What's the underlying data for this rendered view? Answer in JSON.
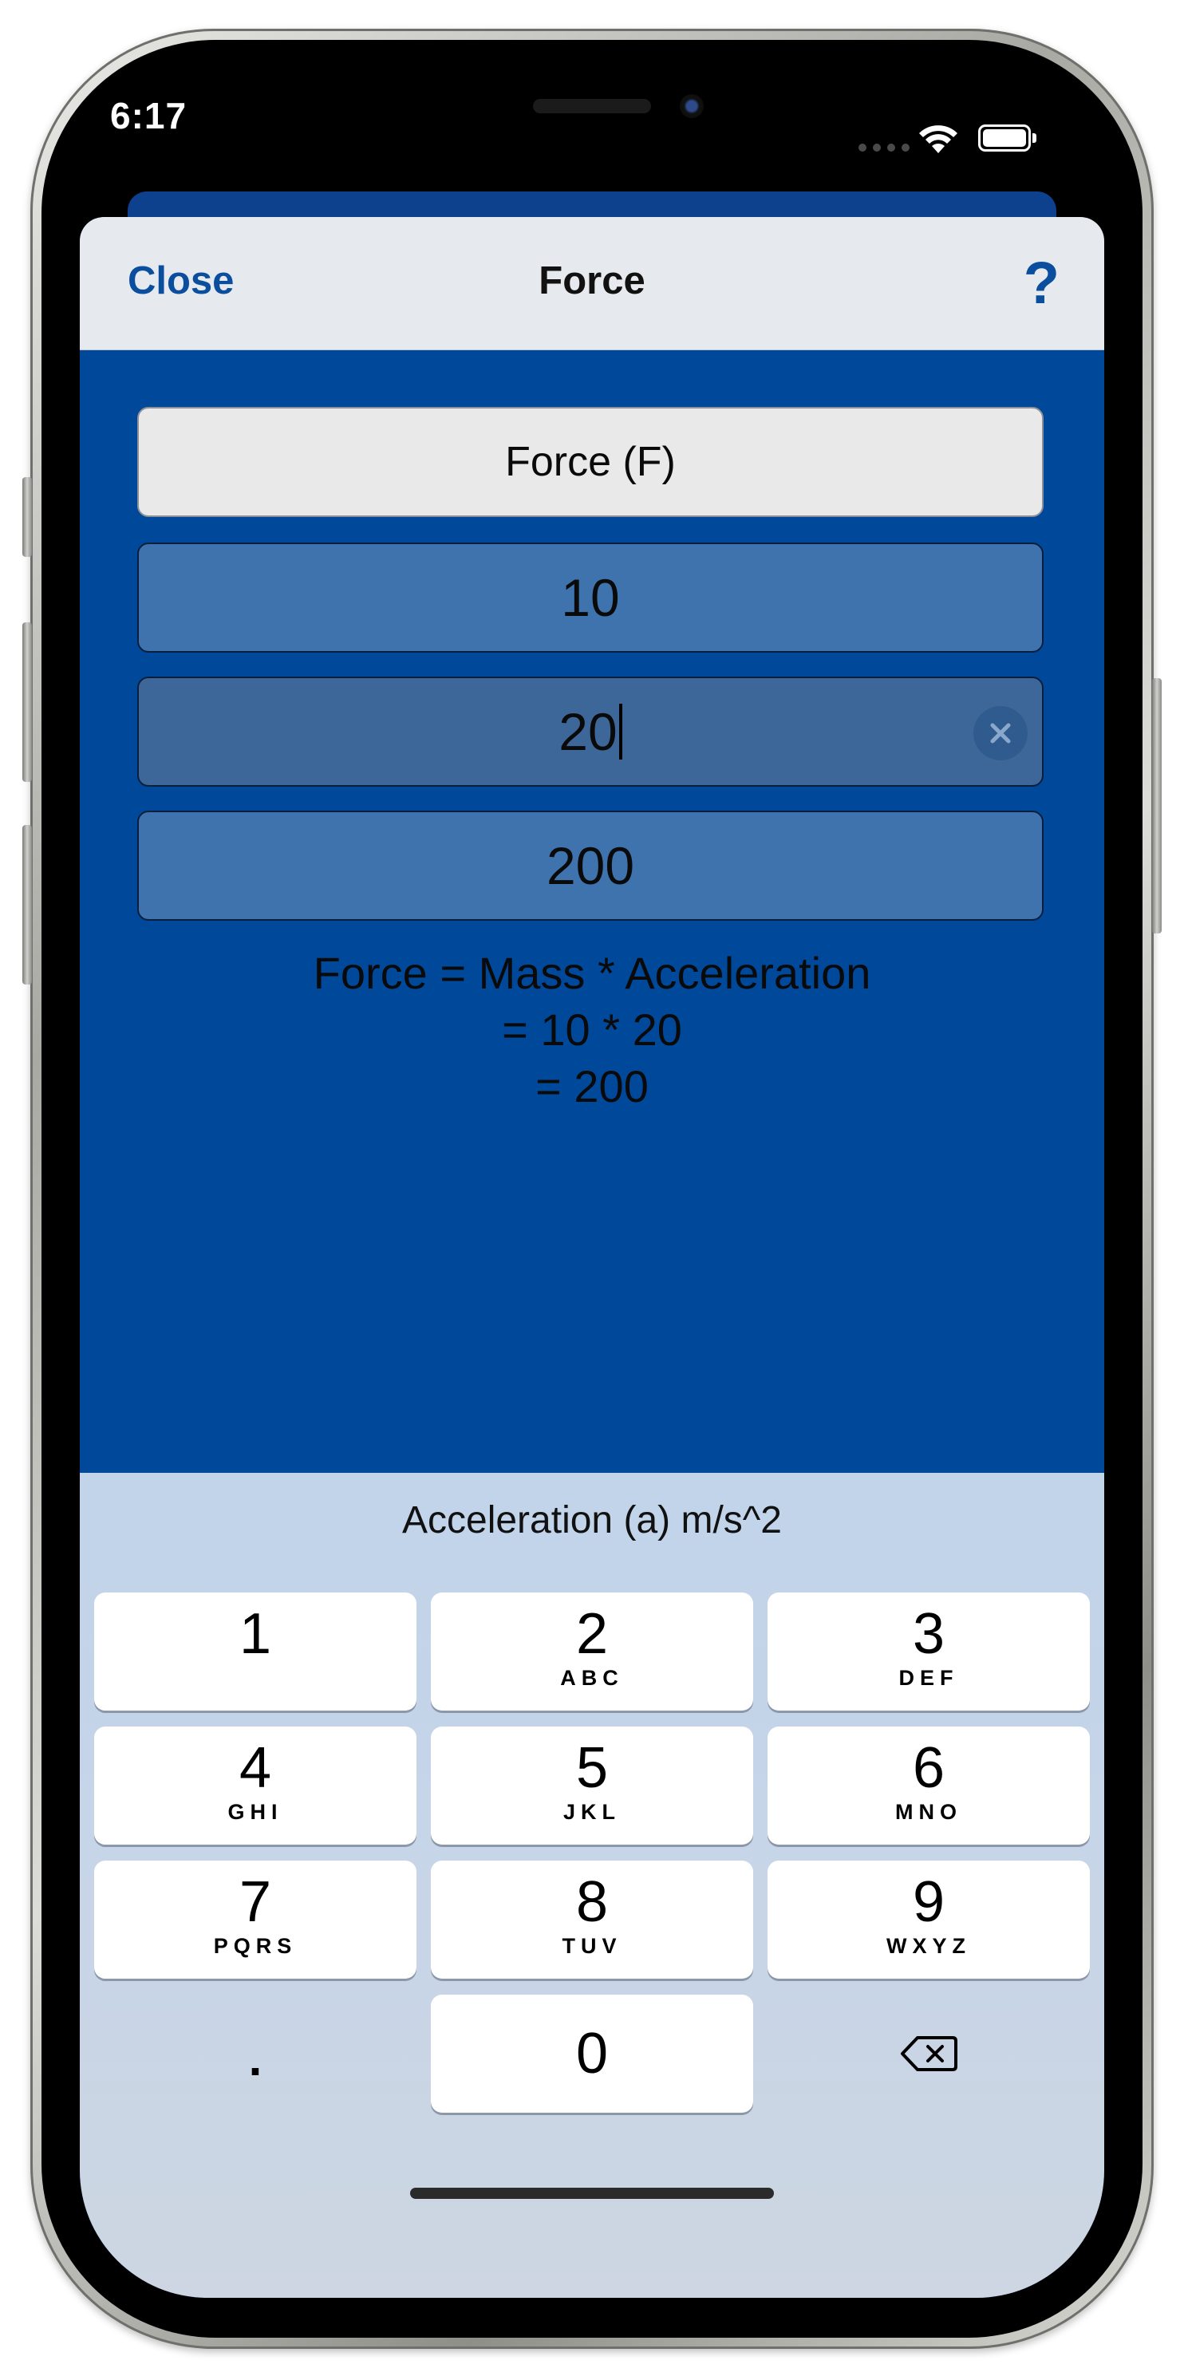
{
  "status_bar": {
    "time": "6:17",
    "icons": [
      "signal-icon",
      "wifi-icon",
      "battery-icon"
    ]
  },
  "nav": {
    "close_label": "Close",
    "title": "Force",
    "help_label": "?"
  },
  "form": {
    "solve_for": "Force (F)",
    "mass_value": "10",
    "acceleration_value": "20",
    "result_value": "200"
  },
  "formula": {
    "line1": "Force = Mass * Acceleration",
    "line2": "= 10 * 20",
    "line3": "= 200"
  },
  "keyboard": {
    "field_label": "Acceleration (a) m/s^2",
    "keys": [
      {
        "digit": "1",
        "letters": ""
      },
      {
        "digit": "2",
        "letters": "ABC"
      },
      {
        "digit": "3",
        "letters": "DEF"
      },
      {
        "digit": "4",
        "letters": "GHI"
      },
      {
        "digit": "5",
        "letters": "JKL"
      },
      {
        "digit": "6",
        "letters": "MNO"
      },
      {
        "digit": "7",
        "letters": "PQRS"
      },
      {
        "digit": "8",
        "letters": "TUV"
      },
      {
        "digit": "9",
        "letters": "WXYZ"
      },
      {
        "digit": "0",
        "letters": ""
      }
    ],
    "decimal_label": ".",
    "delete_icon": "backspace-icon"
  },
  "colors": {
    "sheet_background": "#00489a",
    "navbar_background": "#e6eaee",
    "accent": "#0b4e9e",
    "field_background": "#3f73ad",
    "active_field_background": "#3d6799",
    "keyboard_background": "#c1d4ea"
  }
}
